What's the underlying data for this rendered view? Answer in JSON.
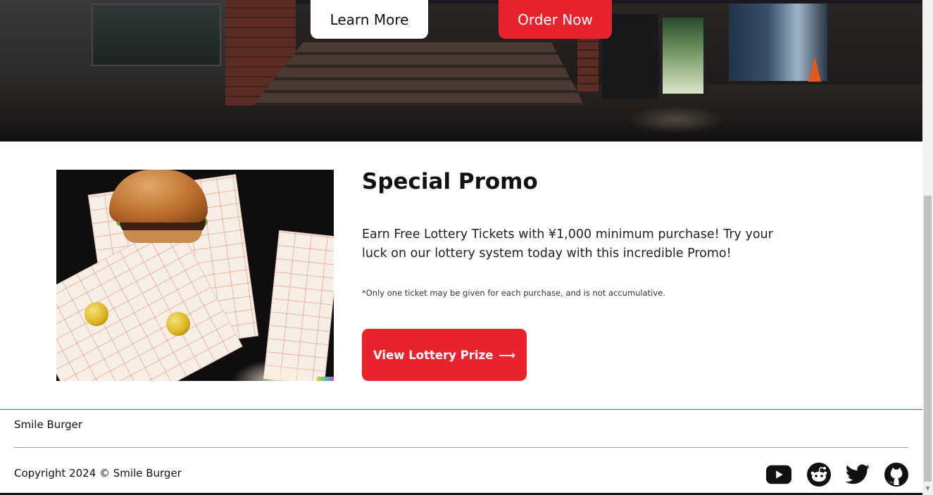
{
  "hero": {
    "learn_more_label": "Learn More",
    "order_now_label": "Order Now"
  },
  "promo": {
    "title": "Special Promo",
    "description": "Earn Free Lottery Tickets with ¥1,000 minimum purchase! Try your luck on our lottery system today with this incredible Promo!",
    "note": "*Only one ticket may be given for each purchase, and is not accumulative.",
    "button_label": "View Lottery Prize",
    "button_arrow": "⟶"
  },
  "footer": {
    "brand": "Smile Burger",
    "copyright": "Copyright 2024 © Smile Burger",
    "social": [
      "youtube-icon",
      "reddit-icon",
      "twitter-icon",
      "github-icon"
    ]
  },
  "colors": {
    "accent": "#e8232e",
    "footer_line": "#b3474c"
  }
}
